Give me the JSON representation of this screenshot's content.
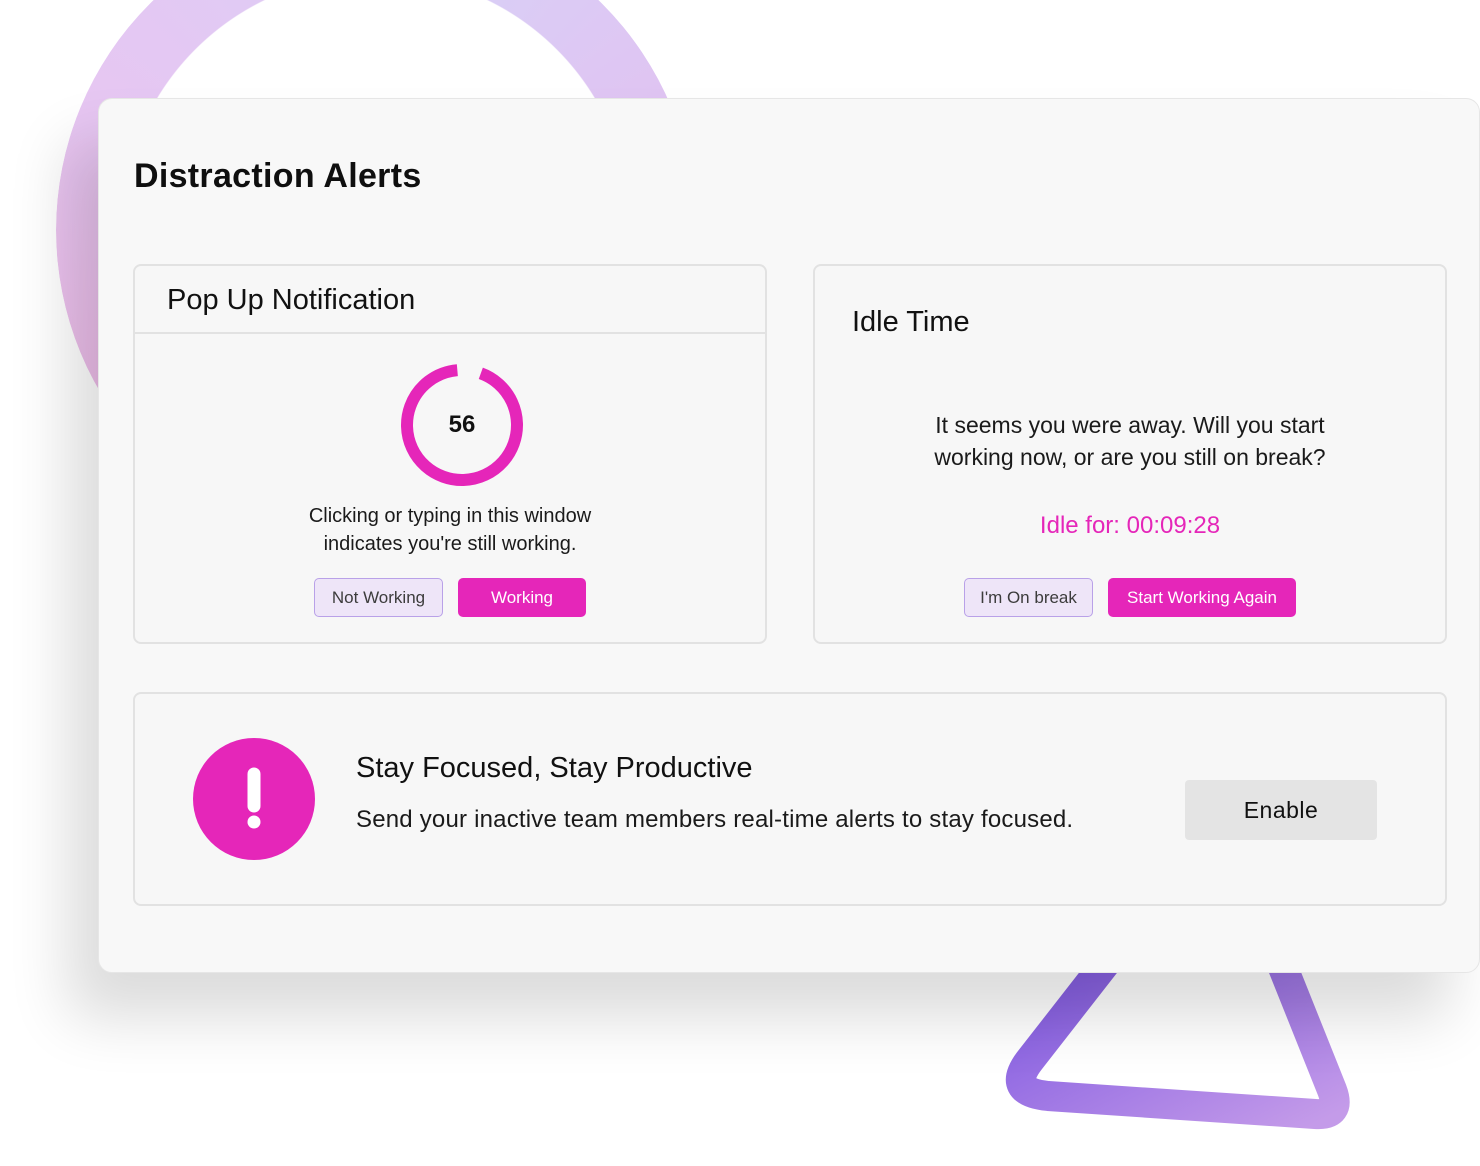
{
  "page": {
    "title": "Distraction Alerts"
  },
  "popup": {
    "title": "Pop Up Notification",
    "countdown": "56",
    "countdown_progress": 0.93,
    "message": "Clicking or typing in this window\nindicates you're still working.",
    "not_working_label": "Not Working",
    "working_label": "Working"
  },
  "idle": {
    "title": "Idle Time",
    "message": "It seems you were away. Will you start\nworking now, or are you still on break?",
    "timer": "Idle for: 00:09:28",
    "on_break_label": "I'm On break",
    "start_working_label": "Start Working Again"
  },
  "focus": {
    "icon": "exclamation-icon",
    "title": "Stay Focused, Stay Productive",
    "description": "Send your inactive team members real-time alerts to stay focused.",
    "enable_label": "Enable"
  },
  "colors": {
    "accent": "#e526b9",
    "outline_button_bg": "#eee5f8",
    "outline_button_border": "#b9a1e8",
    "enable_button_bg": "#e4e4e4"
  }
}
